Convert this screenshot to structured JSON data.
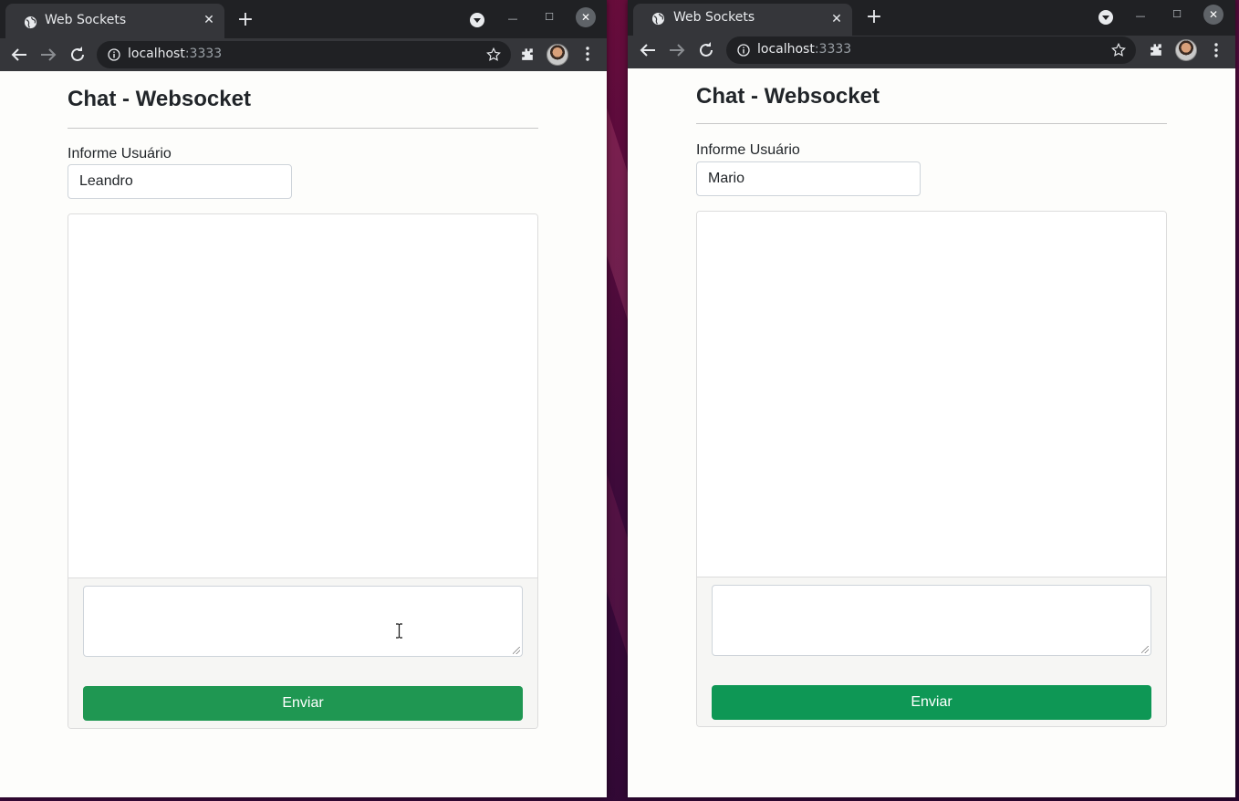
{
  "windows": [
    {
      "id": "left",
      "tab_title": "Web Sockets",
      "url_host": "localhost",
      "url_port": ":3333",
      "page_title": "Chat - Websocket",
      "user_label": "Informe Usuário",
      "user_value": "Leandro",
      "message_value": "",
      "send_label": "Enviar"
    },
    {
      "id": "right",
      "tab_title": "Web Sockets",
      "url_host": "localhost",
      "url_port": ":3333",
      "page_title": "Chat - Websocket",
      "user_label": "Informe Usuário",
      "user_value": "Mario",
      "message_value": "",
      "send_label": "Enviar"
    }
  ],
  "colors": {
    "send_button": "#1f9752",
    "tab_bar": "#202124",
    "toolbar": "#35363a",
    "desktop": "#5b0b3c"
  },
  "icons": [
    "globe-icon",
    "close-icon",
    "plus-icon",
    "tab-search-icon",
    "minimize-icon",
    "maximize-icon",
    "back-arrow-icon",
    "forward-arrow-icon",
    "reload-icon",
    "info-icon",
    "star-icon",
    "puzzle-icon",
    "profile-avatar",
    "kebab-menu-icon",
    "text-cursor-icon"
  ]
}
